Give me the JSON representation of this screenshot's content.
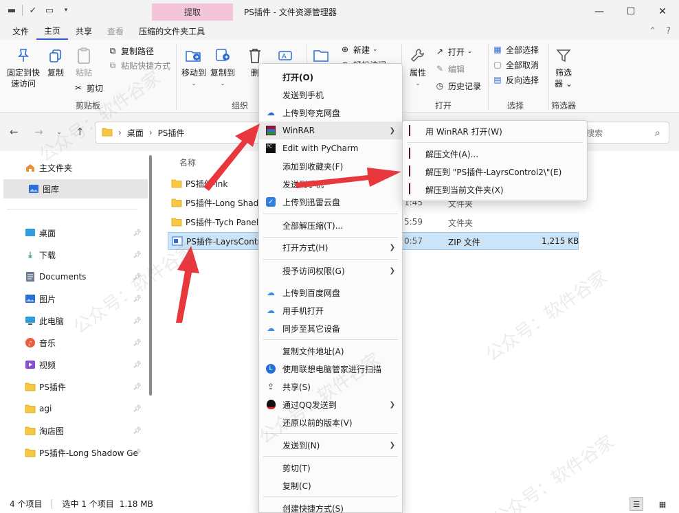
{
  "window": {
    "title": "PS插件 - 文件资源管理器",
    "context_tab": "提取",
    "controls": {
      "minimize": "—",
      "maximize": "☐",
      "close": "✕"
    }
  },
  "ribbon_tabs": [
    {
      "label": "文件"
    },
    {
      "label": "主页"
    },
    {
      "label": "共享"
    },
    {
      "label": "查看"
    },
    {
      "label": "压缩的文件夹工具"
    }
  ],
  "ribbon": {
    "pin_label_1": "固定到快",
    "pin_label_2": "速访问",
    "copy": "复制",
    "paste": "粘贴",
    "copy_path": "复制路径",
    "paste_shortcut": "粘贴快捷方式",
    "cut": "剪切",
    "clipboard_group": "剪贴板",
    "move_to": "移动到",
    "copy_to": "复制到",
    "delete": "删",
    "rename": "重",
    "organize_group": "组织",
    "new_item": "新建",
    "easy_access": "轻松访问",
    "open": "打开",
    "edit": "编辑",
    "history": "历史记录",
    "properties": "属性",
    "open_group": "打开",
    "select_all": "全部选择",
    "select_none": "全部取消",
    "invert": "反向选择",
    "select_group": "选择",
    "filter": "筛选",
    "filter_sub": "器",
    "filter_group": "筛选器"
  },
  "address": {
    "path": [
      "桌面",
      "PS插件"
    ],
    "search_placeholder": "搜索"
  },
  "nav_pane": [
    {
      "label": "主文件夹",
      "icon": "home-icon"
    },
    {
      "label": "图库",
      "icon": "gallery-icon"
    },
    {
      "label": "桌面",
      "icon": "desktop-icon"
    },
    {
      "label": "下载",
      "icon": "download-icon"
    },
    {
      "label": "Documents",
      "icon": "document-icon"
    },
    {
      "label": "图片",
      "icon": "picture-icon"
    },
    {
      "label": "此电脑",
      "icon": "computer-icon"
    },
    {
      "label": "音乐",
      "icon": "music-icon"
    },
    {
      "label": "视频",
      "icon": "video-icon"
    },
    {
      "label": "PS插件",
      "icon": "folder-icon"
    },
    {
      "label": "agi",
      "icon": "folder-icon"
    },
    {
      "label": "淘店图",
      "icon": "folder-icon"
    },
    {
      "label": "PS插件-Long Shadow Ge",
      "icon": "folder-icon"
    }
  ],
  "files": {
    "col_name": "名称",
    "rows": [
      {
        "name": "PS插件-Ink",
        "time": "",
        "type": "",
        "size": ""
      },
      {
        "name": "PS插件-Long Shad",
        "time": "1:45",
        "type": "文件夹",
        "size": ""
      },
      {
        "name": "PS插件-Tych Panel",
        "time": "5:59",
        "type": "文件夹",
        "size": ""
      },
      {
        "name": "PS插件-LayrsContr",
        "time": "0:57",
        "type": "ZIP 文件",
        "size": "1,215 KB"
      }
    ]
  },
  "status": {
    "count": "4 个项目",
    "selected": "选中 1 个项目",
    "size": "1.18 MB"
  },
  "context_menu": [
    {
      "label": "打开(O)",
      "bold": true
    },
    {
      "label": "发送到手机"
    },
    {
      "label": "上传到夸克网盘"
    },
    {
      "label": "WinRAR",
      "submenu": true
    },
    {
      "label": "Edit with PyCharm"
    },
    {
      "label": "添加到收藏夹(F)"
    },
    {
      "label": "发送到手机"
    },
    {
      "label": "上传到迅雷云盘"
    },
    {
      "label": "全部解压缩(T)..."
    },
    {
      "label": "打开方式(H)",
      "submenu": true
    },
    {
      "label": "授予访问权限(G)",
      "submenu": true
    },
    {
      "label": "上传到百度网盘"
    },
    {
      "label": "用手机打开"
    },
    {
      "label": "同步至其它设备"
    },
    {
      "label": "复制文件地址(A)"
    },
    {
      "label": "使用联想电脑管家进行扫描"
    },
    {
      "label": "共享(S)"
    },
    {
      "label": "通过QQ发送到",
      "submenu": true
    },
    {
      "label": "还原以前的版本(V)"
    },
    {
      "label": "发送到(N)",
      "submenu": true
    },
    {
      "label": "剪切(T)"
    },
    {
      "label": "复制(C)"
    },
    {
      "label": "创建快捷方式(S)"
    }
  ],
  "winrar_submenu": [
    {
      "label": "用 WinRAR 打开(W)"
    },
    {
      "label": "解压文件(A)..."
    },
    {
      "label": "解压到 \"PS插件-LayrsControl2\\\"(E)"
    },
    {
      "label": "解压到当前文件夹(X)"
    }
  ],
  "watermark": "公众号：软件谷家",
  "colors": {
    "accent": "#2a5ad7",
    "selection": "#cce4f7",
    "context_tab": "#f4c5d8",
    "arrow": "#e8383d"
  }
}
